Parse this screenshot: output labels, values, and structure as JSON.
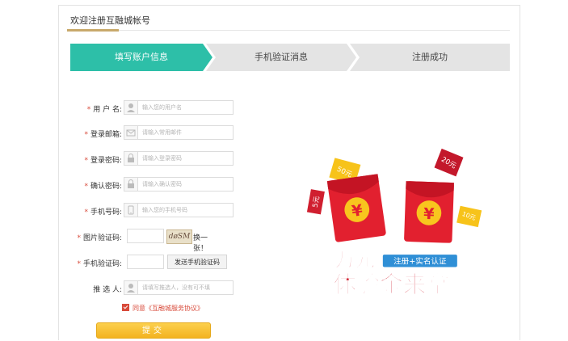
{
  "header": {
    "title": "欢迎注册互融城帐号"
  },
  "steps": [
    {
      "label": "填写账户信息",
      "active": true
    },
    {
      "label": "手机验证消息",
      "active": false
    },
    {
      "label": "注册成功",
      "active": false
    }
  ],
  "colors": {
    "active_step": "#2dbfa8",
    "inactive_step": "#e4e4e4",
    "required": "#d84a3a",
    "submit": "#f5ba2b"
  },
  "form": {
    "username": {
      "label": "用 户 名:",
      "placeholder": "输入您的用户名",
      "icon": "user-icon"
    },
    "email": {
      "label": "登录邮箱:",
      "placeholder": "请输入常用邮件",
      "icon": "mail-icon"
    },
    "password": {
      "label": "登录密码:",
      "placeholder": "请输入登录密码",
      "icon": "lock-icon"
    },
    "confirm_password": {
      "label": "确认密码:",
      "placeholder": "请输入确认密码",
      "icon": "lock-icon"
    },
    "phone": {
      "label": "手机号码:",
      "placeholder": "输入您的手机号码",
      "icon": "phone-icon"
    },
    "image_captcha": {
      "label": "图片验证码:",
      "captcha_text": "døSM",
      "change_label": "换一张！"
    },
    "sms_code": {
      "label": "手机验证码:",
      "send_button": "发送手机验证码"
    },
    "referrer": {
      "label": "推 选 人:",
      "placeholder": "请填写推选人，没有可不填",
      "icon": "person-icon"
    },
    "agreement": {
      "text": "同意《互融城服务协议》",
      "checked": true
    },
    "submit_label": "提交"
  },
  "promo": {
    "headline_1": "万元",
    "headline_2": "体验金来拿",
    "ribbon": "注册+实名认证",
    "coupons": [
      "50元",
      "20元",
      "5元",
      "10元"
    ],
    "currency_symbol": "¥"
  }
}
